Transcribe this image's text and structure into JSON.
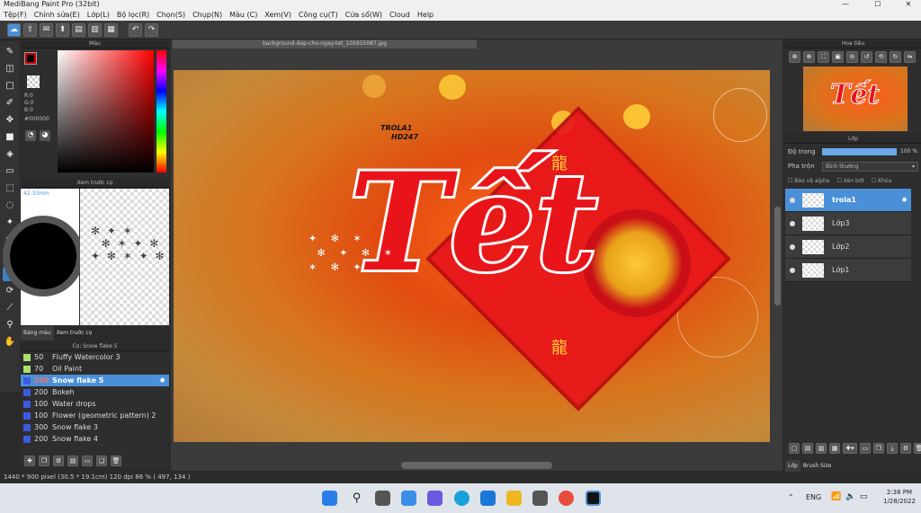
{
  "window": {
    "title": "MediBang Paint Pro (32bit)"
  },
  "menu": [
    "Tệp(F)",
    "Chỉnh sửa(E)",
    "Lớp(L)",
    "Bộ lọc(R)",
    "Chọn(S)",
    "Chụp(N)",
    "Màu (C)",
    "Xem(V)",
    "Công cụ(T)",
    "Cửa sổ(W)",
    "Cloud",
    "Help"
  ],
  "color_panel": {
    "title": "Màu",
    "r": "R:0",
    "g": "G:0",
    "b": "B:0",
    "hex": "#000000",
    "primary_color": "#000000",
    "secondary_color": "#ffffff"
  },
  "brush_preview_panel": {
    "title": "Xem trước cọ",
    "size": "42.33mm",
    "tab_color_table": "Bảng màu",
    "tab_brush_preview": "Xem trước cọ"
  },
  "brush_panel": {
    "title": "Cọ: Snow flake 5",
    "items": [
      {
        "size": "50",
        "name": "Fluffy Watercolor 3",
        "color": "#a8e06a"
      },
      {
        "size": "70",
        "name": "Oil Paint",
        "color": "#a8e06a"
      },
      {
        "size": "200",
        "name": "Snow flake 5",
        "color": "#3a5be0",
        "selected": true
      },
      {
        "size": "200",
        "name": "Bokeh",
        "color": "#3a5be0"
      },
      {
        "size": "100",
        "name": "Water drops",
        "color": "#3a5be0"
      },
      {
        "size": "100",
        "name": "Flower (geometric pattern) 2",
        "color": "#3a5be0"
      },
      {
        "size": "300",
        "name": "Snow flake 3",
        "color": "#3a5be0"
      },
      {
        "size": "200",
        "name": "Snow flake 4",
        "color": "#3a5be0"
      }
    ]
  },
  "document": {
    "tab": "background-dep-cho-ngay-tet_105955087.jpg",
    "watermark_line1": "TROLA1",
    "watermark_line2": "HD247",
    "headline": "Tết"
  },
  "navigator": {
    "title": "Hoa tiêu"
  },
  "layer_panel": {
    "title": "Lớp",
    "opacity_label": "Độ trong",
    "opacity_value": "100 %",
    "opacity_fraction": 1.0,
    "blend_label": "Pha trộn",
    "blend_value": "Bình thường",
    "protect_alpha": "Bảo vệ alpha",
    "clipping": "Xén bớt",
    "lock": "Khóa",
    "layers": [
      {
        "name": "trola1",
        "selected": true
      },
      {
        "name": "Lớp3"
      },
      {
        "name": "Lớp2"
      },
      {
        "name": "Lớp1"
      }
    ],
    "tab_layer": "Lớp",
    "tab_brush_size": "Brush Size"
  },
  "status": "1440 * 900 pixel   (30.5 * 19.1cm)   120 dpi   86 %   ( 497, 134 )",
  "taskbar": {
    "lang": "ENG",
    "time": "2:38 PM",
    "date": "1/28/2022"
  }
}
